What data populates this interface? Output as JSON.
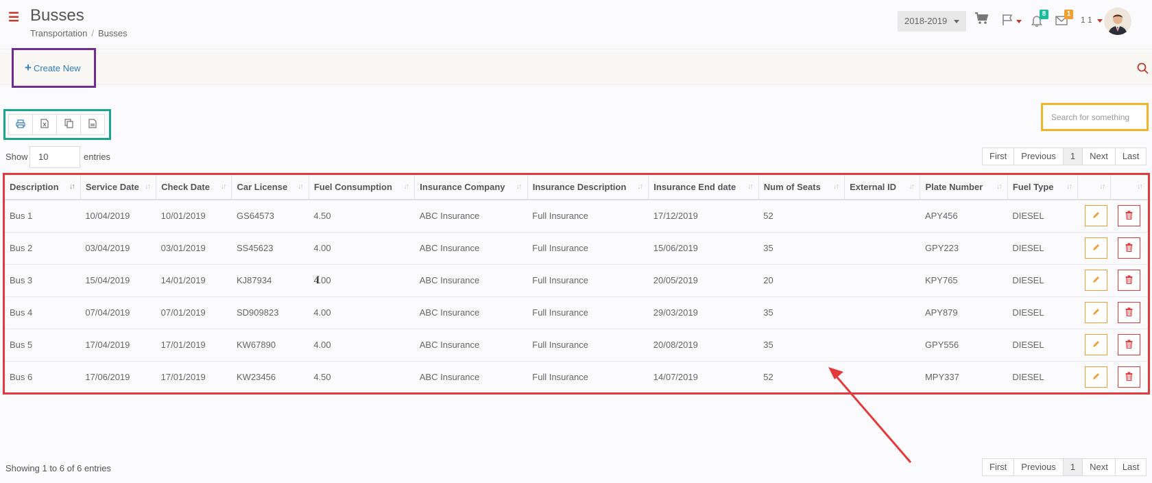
{
  "header": {
    "title": "Busses",
    "breadcrumb": [
      "Transportation",
      "Busses"
    ],
    "year": "2018-2019",
    "notifications_count": "8",
    "messages_count": "1",
    "user_name": "1 1"
  },
  "toolbar": {
    "create_label": "Create New"
  },
  "export_buttons": [
    "print-icon",
    "excel-icon",
    "copy-icon",
    "csv-icon"
  ],
  "search": {
    "placeholder": "Search for something"
  },
  "length": {
    "show_label": "Show",
    "value": "10",
    "entries_label": "entries"
  },
  "pagination": {
    "first": "First",
    "previous": "Previous",
    "page": "1",
    "next": "Next",
    "last": "Last"
  },
  "table": {
    "columns": [
      "Description",
      "Service Date",
      "Check Date",
      "Car License",
      "Fuel Consumption",
      "Insurance Company",
      "Insurance Description",
      "Insurance End date",
      "Num of Seats",
      "External ID",
      "Plate Number",
      "Fuel Type",
      "",
      ""
    ],
    "rows": [
      [
        "Bus 1",
        "10/04/2019",
        "10/01/2019",
        "GS64573",
        "4.50",
        "ABC Insurance",
        "Full Insurance",
        "17/12/2019",
        "52",
        "",
        "APY456",
        "DIESEL"
      ],
      [
        "Bus 2",
        "03/04/2019",
        "03/01/2019",
        "SS45623",
        "4.00",
        "ABC Insurance",
        "Full Insurance",
        "15/06/2019",
        "35",
        "",
        "GPY223",
        "DIESEL"
      ],
      [
        "Bus 3",
        "15/04/2019",
        "14/01/2019",
        "KJ87934",
        "4.00",
        "ABC Insurance",
        "Full Insurance",
        "20/05/2019",
        "20",
        "",
        "KPY765",
        "DIESEL"
      ],
      [
        "Bus 4",
        "07/04/2019",
        "07/01/2019",
        "SD909823",
        "4.00",
        "ABC Insurance",
        "Full Insurance",
        "29/03/2019",
        "35",
        "",
        "APY879",
        "DIESEL"
      ],
      [
        "Bus 5",
        "17/04/2019",
        "17/01/2019",
        "KW67890",
        "4.00",
        "ABC Insurance",
        "Full Insurance",
        "20/08/2019",
        "35",
        "",
        "GPY556",
        "DIESEL"
      ],
      [
        "Bus 6",
        "17/06/2019",
        "17/01/2019",
        "KW23456",
        "4.50",
        "ABC Insurance",
        "Full Insurance",
        "14/07/2019",
        "52",
        "",
        "MPY337",
        "DIESEL"
      ]
    ]
  },
  "footer": {
    "info": "Showing 1 to 6 of 6 entries"
  },
  "colors": {
    "accent_red": "#c0392b",
    "link_blue": "#2f7fc1",
    "edit_orange": "#f0a030",
    "delete_red": "#e4393b"
  }
}
